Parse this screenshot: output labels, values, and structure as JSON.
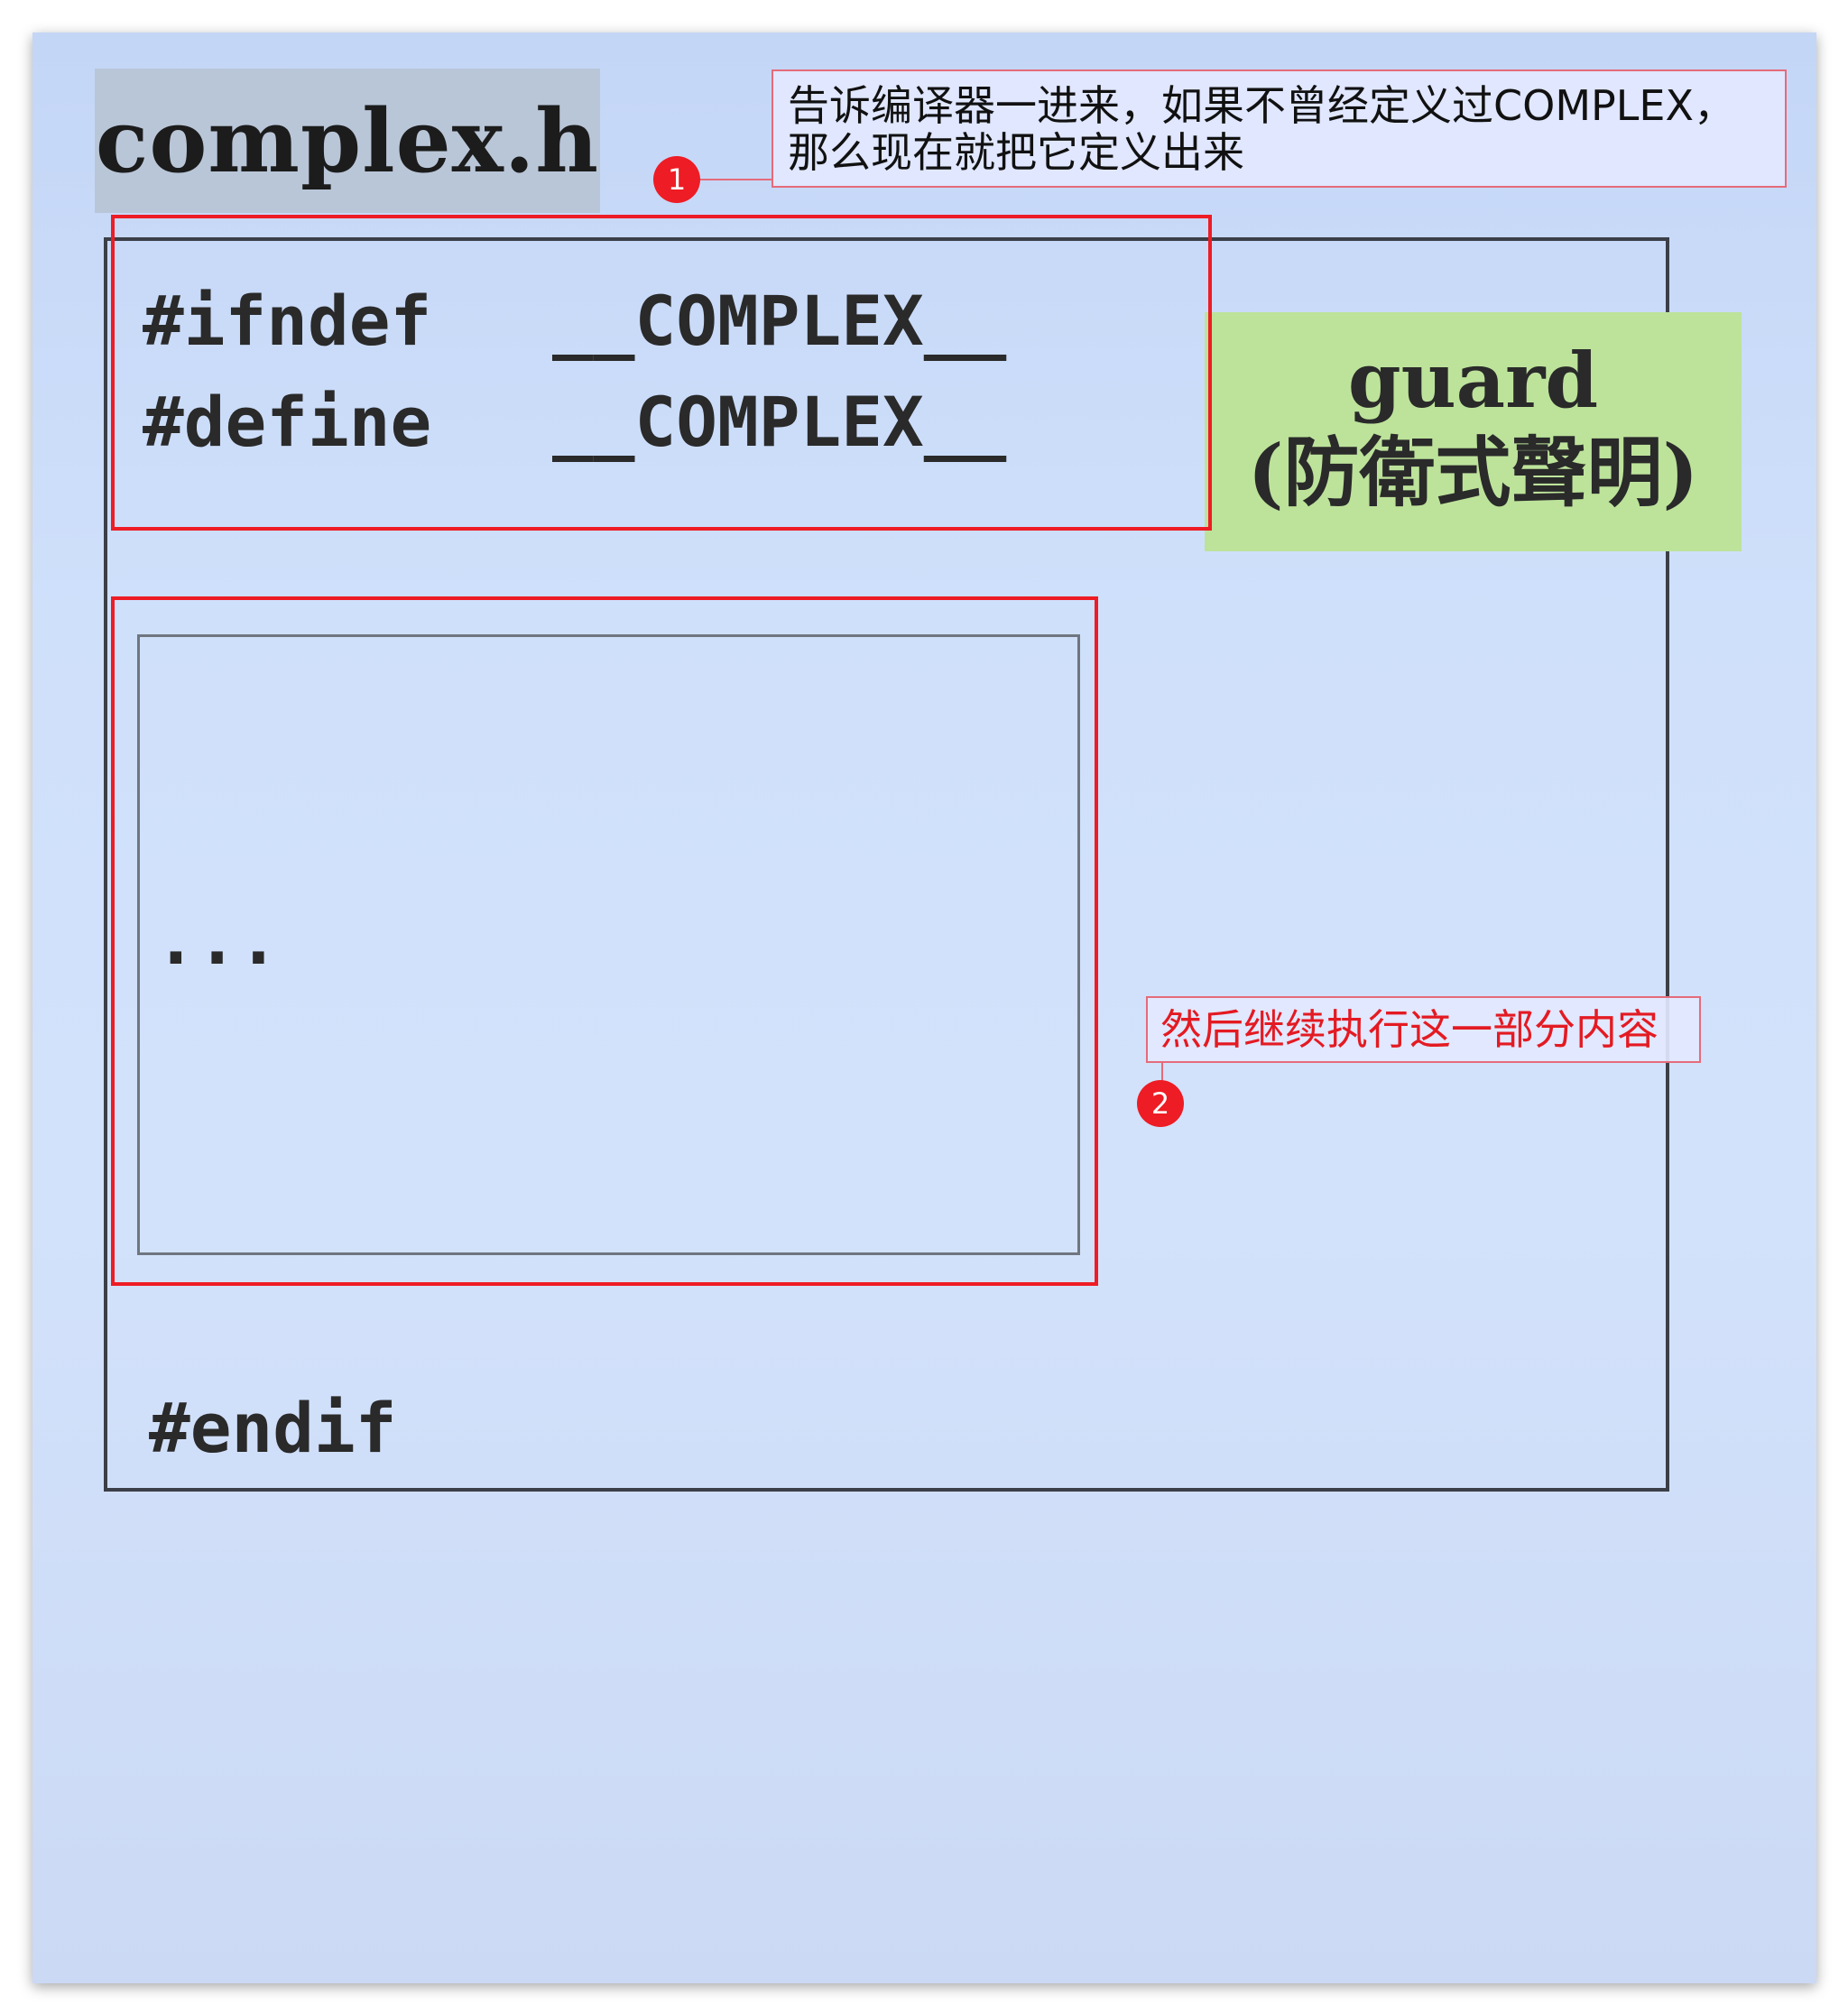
{
  "file_tab": {
    "label": "complex.h"
  },
  "code_lines": {
    "ifndef_directive": "#ifndef",
    "define_directive": "#define",
    "macro_name": "__COMPLEX__",
    "ellipsis": "...",
    "endif_directive": "#endif"
  },
  "guard_badge": {
    "title": "guard",
    "subtitle": "(防衛式聲明)"
  },
  "annotations": [
    {
      "number": "1",
      "text": "告诉编译器一进来，如果不曾经定义过COMPLEX，\n那么现在就把它定义出来"
    },
    {
      "number": "2",
      "text": "然后继续执行这一部分内容"
    }
  ],
  "colors": {
    "highlight_red": "#ee1c24",
    "guard_green": "#bde39b",
    "background_blue": "#cfe0fb"
  }
}
